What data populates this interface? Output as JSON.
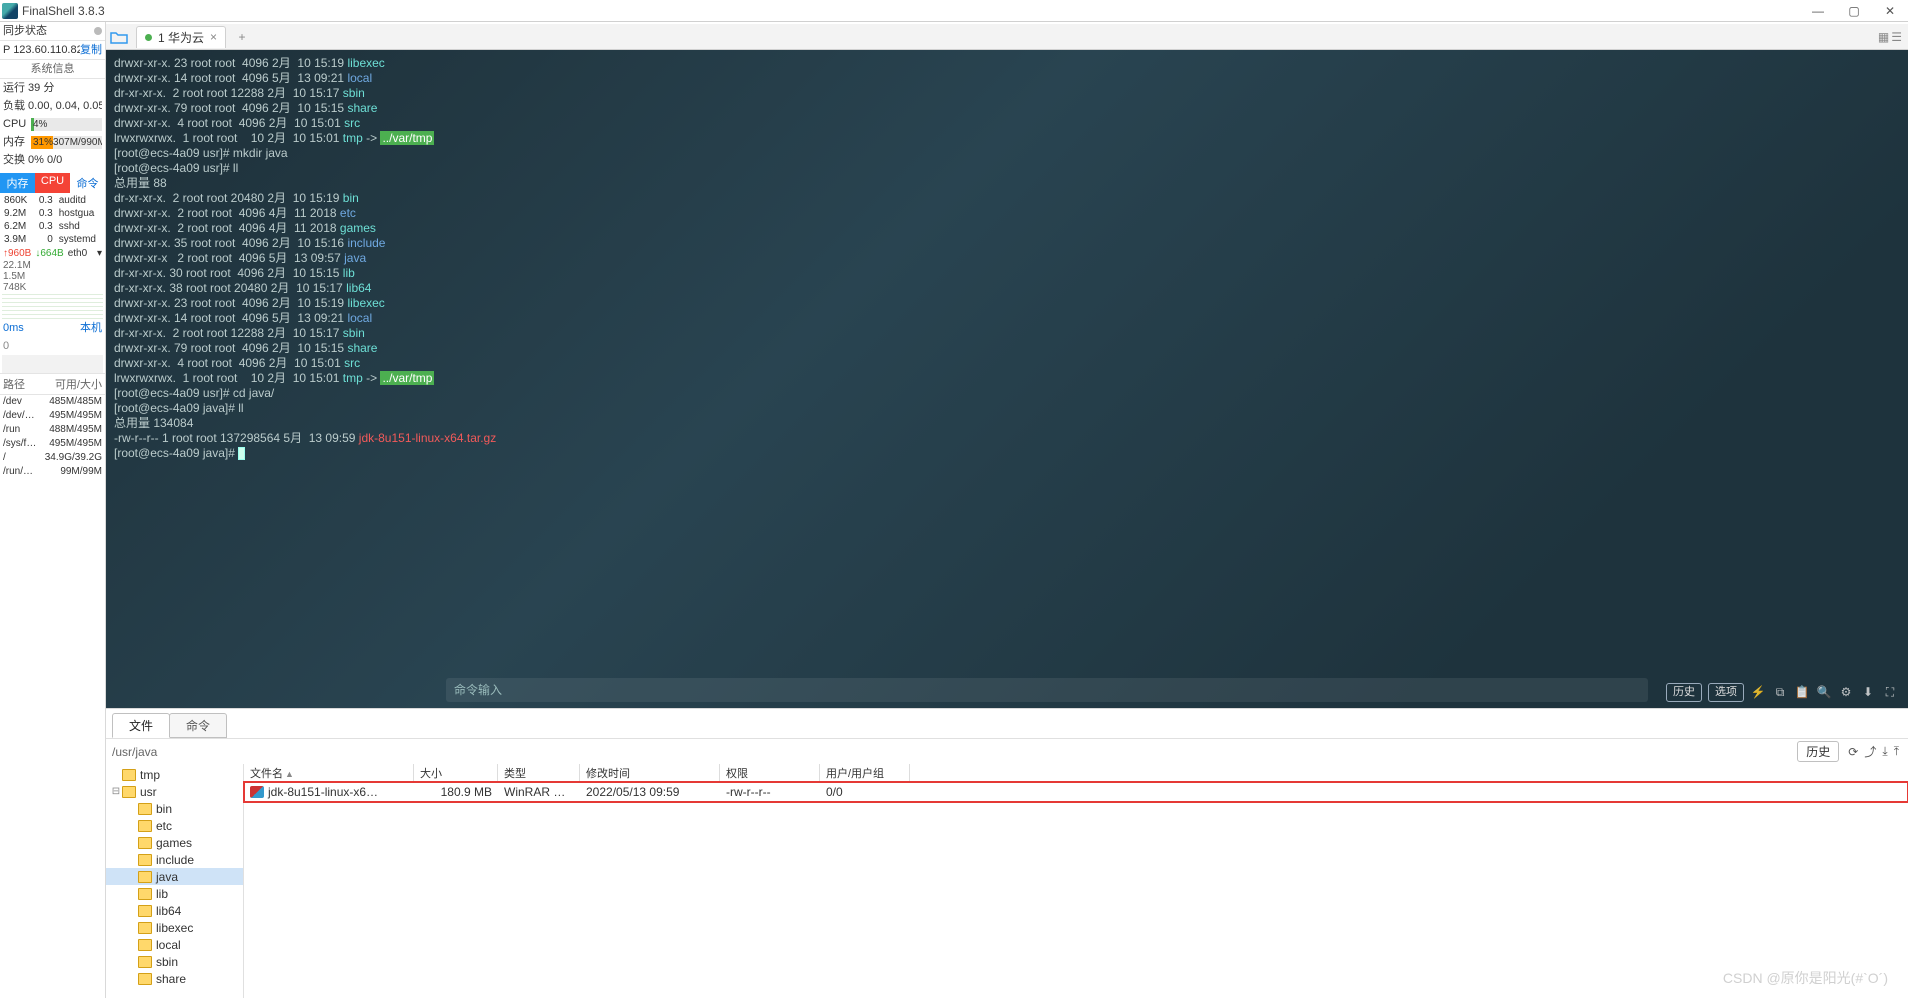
{
  "title": "FinalShell 3.8.3",
  "win": {
    "min": "—",
    "max": "▢",
    "close": "✕"
  },
  "sidebar": {
    "sync": {
      "label": "同步状态",
      "dot": true
    },
    "ip": {
      "label": "P 123.60.110.82",
      "copy": "复制"
    },
    "sysinfo": "系统信息",
    "runtime": "运行 39 分",
    "load": "负载 0.00, 0.04, 0.05",
    "cpu": {
      "label": "CPU",
      "pct": "4%",
      "w": 4
    },
    "mem": {
      "label": "内存",
      "pct": "31%",
      "txt": "307M/990M",
      "w": 31
    },
    "swap": "交换 0%    0/0",
    "tabs": [
      "内存",
      "CPU",
      "命令"
    ],
    "procs": [
      {
        "a": "860K",
        "b": "0.3",
        "c": "auditd"
      },
      {
        "a": "9.2M",
        "b": "0.3",
        "c": "hostgua"
      },
      {
        "a": "6.2M",
        "b": "0.3",
        "c": "sshd"
      },
      {
        "a": "3.9M",
        "b": "0",
        "c": "systemd"
      }
    ],
    "net": {
      "up": "↑960B",
      "dn": "↓664B",
      "if": "eth0",
      "more": "▾"
    },
    "netnums": [
      "22.1M",
      "1.5M",
      "748K"
    ],
    "ping": {
      "ms": "0ms",
      "local": "本机"
    },
    "ping2": "0",
    "fs_head": [
      "路径",
      "可用/大小"
    ],
    "fs": [
      {
        "p": "/dev",
        "s": "485M/485M"
      },
      {
        "p": "/dev/…",
        "s": "495M/495M"
      },
      {
        "p": "/run",
        "s": "488M/495M"
      },
      {
        "p": "/sys/f…",
        "s": "495M/495M"
      },
      {
        "p": "/",
        "s": "34.9G/39.2G"
      },
      {
        "p": "/run/…",
        "s": "99M/99M"
      }
    ]
  },
  "tab": {
    "label": "1 华为云",
    "add": "+"
  },
  "term": {
    "lines": [
      {
        "p": "drwxr-xr-x. 23 root root  4096 2月  10 15:19 ",
        "s": "libexec",
        "c": "cy"
      },
      {
        "p": "drwxr-xr-x. 14 root root  4096 5月  13 09:21 ",
        "s": "local",
        "c": "bl"
      },
      {
        "p": "dr-xr-xr-x.  2 root root 12288 2月  10 15:17 ",
        "s": "sbin",
        "c": "cy"
      },
      {
        "p": "drwxr-xr-x. 79 root root  4096 2月  10 15:15 ",
        "s": "share",
        "c": "cy"
      },
      {
        "p": "drwxr-xr-x.  4 root root  4096 2月  10 15:01 ",
        "s": "src",
        "c": "cy"
      },
      {
        "p": "lrwxrwxrwx.  1 root root    10 2月  10 15:01 ",
        "s": "tmp",
        "c": "cy",
        "arrow": " -> ",
        "t": "../var/tmp",
        "tc": "gr"
      },
      {
        "p": "[root@ecs-4a09 usr]# mkdir java"
      },
      {
        "p": "[root@ecs-4a09 usr]# ll"
      },
      {
        "p": "总用量 88"
      },
      {
        "p": "dr-xr-xr-x.  2 root root 20480 2月  10 15:19 ",
        "s": "bin",
        "c": "cy"
      },
      {
        "p": "drwxr-xr-x.  2 root root  4096 4月  11 2018 ",
        "s": "etc",
        "c": "bl"
      },
      {
        "p": "drwxr-xr-x.  2 root root  4096 4月  11 2018 ",
        "s": "games",
        "c": "cy"
      },
      {
        "p": "drwxr-xr-x. 35 root root  4096 2月  10 15:16 ",
        "s": "include",
        "c": "bl"
      },
      {
        "p": "drwxr-xr-x   2 root root  4096 5月  13 09:57 ",
        "s": "java",
        "c": "bl"
      },
      {
        "p": "dr-xr-xr-x. 30 root root  4096 2月  10 15:15 ",
        "s": "lib",
        "c": "cy"
      },
      {
        "p": "dr-xr-xr-x. 38 root root 20480 2月  10 15:17 ",
        "s": "lib64",
        "c": "cy"
      },
      {
        "p": "drwxr-xr-x. 23 root root  4096 2月  10 15:19 ",
        "s": "libexec",
        "c": "cy"
      },
      {
        "p": "drwxr-xr-x. 14 root root  4096 5月  13 09:21 ",
        "s": "local",
        "c": "bl"
      },
      {
        "p": "dr-xr-xr-x.  2 root root 12288 2月  10 15:17 ",
        "s": "sbin",
        "c": "cy"
      },
      {
        "p": "drwxr-xr-x. 79 root root  4096 2月  10 15:15 ",
        "s": "share",
        "c": "cy"
      },
      {
        "p": "drwxr-xr-x.  4 root root  4096 2月  10 15:01 ",
        "s": "src",
        "c": "cy"
      },
      {
        "p": "lrwxrwxrwx.  1 root root    10 2月  10 15:01 ",
        "s": "tmp",
        "c": "cy",
        "arrow": " -> ",
        "t": "../var/tmp",
        "tc": "gr"
      },
      {
        "p": "[root@ecs-4a09 usr]# cd java/"
      },
      {
        "p": "[root@ecs-4a09 java]# ll"
      },
      {
        "p": "总用量 134084"
      },
      {
        "p": "-rw-r--r-- 1 root root 137298564 5月  13 09:59 ",
        "s": "jdk-8u151-linux-x64.tar.gz",
        "c": "rd"
      },
      {
        "p": "[root@ecs-4a09 java]# ",
        "cur": true
      }
    ],
    "cmd_ph": "命令输入",
    "tools": {
      "hist": "历史",
      "opt": "选项"
    }
  },
  "bottom": {
    "tabs": [
      "文件",
      "命令"
    ],
    "path": "/usr/java",
    "hist": "历史",
    "tree": [
      {
        "d": 0,
        "exp": "",
        "n": "tmp"
      },
      {
        "d": 0,
        "exp": "⊟",
        "n": "usr"
      },
      {
        "d": 1,
        "exp": "",
        "n": "bin"
      },
      {
        "d": 1,
        "exp": "",
        "n": "etc"
      },
      {
        "d": 1,
        "exp": "",
        "n": "games"
      },
      {
        "d": 1,
        "exp": "",
        "n": "include"
      },
      {
        "d": 1,
        "exp": "",
        "n": "java",
        "sel": true
      },
      {
        "d": 1,
        "exp": "",
        "n": "lib"
      },
      {
        "d": 1,
        "exp": "",
        "n": "lib64"
      },
      {
        "d": 1,
        "exp": "",
        "n": "libexec"
      },
      {
        "d": 1,
        "exp": "",
        "n": "local"
      },
      {
        "d": 1,
        "exp": "",
        "n": "sbin"
      },
      {
        "d": 1,
        "exp": "",
        "n": "share"
      }
    ],
    "cols": [
      "文件名",
      "大小",
      "类型",
      "修改时间",
      "权限",
      "用户/用户组"
    ],
    "row": {
      "name": "jdk-8u151-linux-x6…",
      "size": "180.9 MB",
      "type": "WinRAR …",
      "mtime": "2022/05/13 09:59",
      "perm": "-rw-r--r--",
      "own": "0/0"
    }
  },
  "watermark": "CSDN @原你是阳光(#`O´)"
}
